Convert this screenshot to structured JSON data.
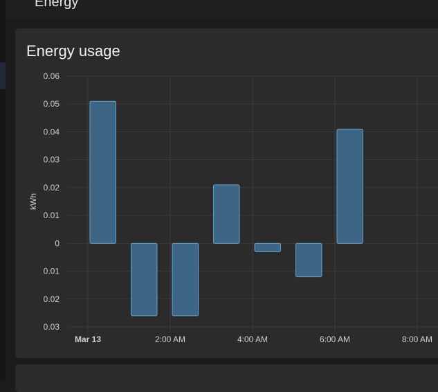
{
  "header": {
    "title": "Energy"
  },
  "card": {
    "title": "Energy usage"
  },
  "colors": {
    "bar_fill": "#3f6584",
    "bar_stroke": "#5fa2d4",
    "grid": "#3b3b3b"
  },
  "chart_data": {
    "type": "bar",
    "ylabel": "kWh",
    "ylim": [
      -0.03,
      0.06
    ],
    "y_ticks": [
      0.06,
      0.05,
      0.04,
      0.03,
      0.02,
      0.01,
      0,
      -0.01,
      -0.02,
      -0.03
    ],
    "y_tick_labels": [
      "0.06",
      "0.05",
      "0.04",
      "0.03",
      "0.02",
      "0.01",
      "0",
      "0.01",
      "0.02",
      "0.03"
    ],
    "x_ticks": [
      "Mar 13",
      "2:00 AM",
      "4:00 AM",
      "6:00 AM",
      "8:00 AM"
    ],
    "hour_offsets": [
      0,
      1,
      2,
      3,
      4,
      5,
      6
    ],
    "values": [
      0.051,
      -0.026,
      -0.026,
      0.021,
      -0.003,
      -0.012,
      0.041
    ],
    "grid": true
  }
}
